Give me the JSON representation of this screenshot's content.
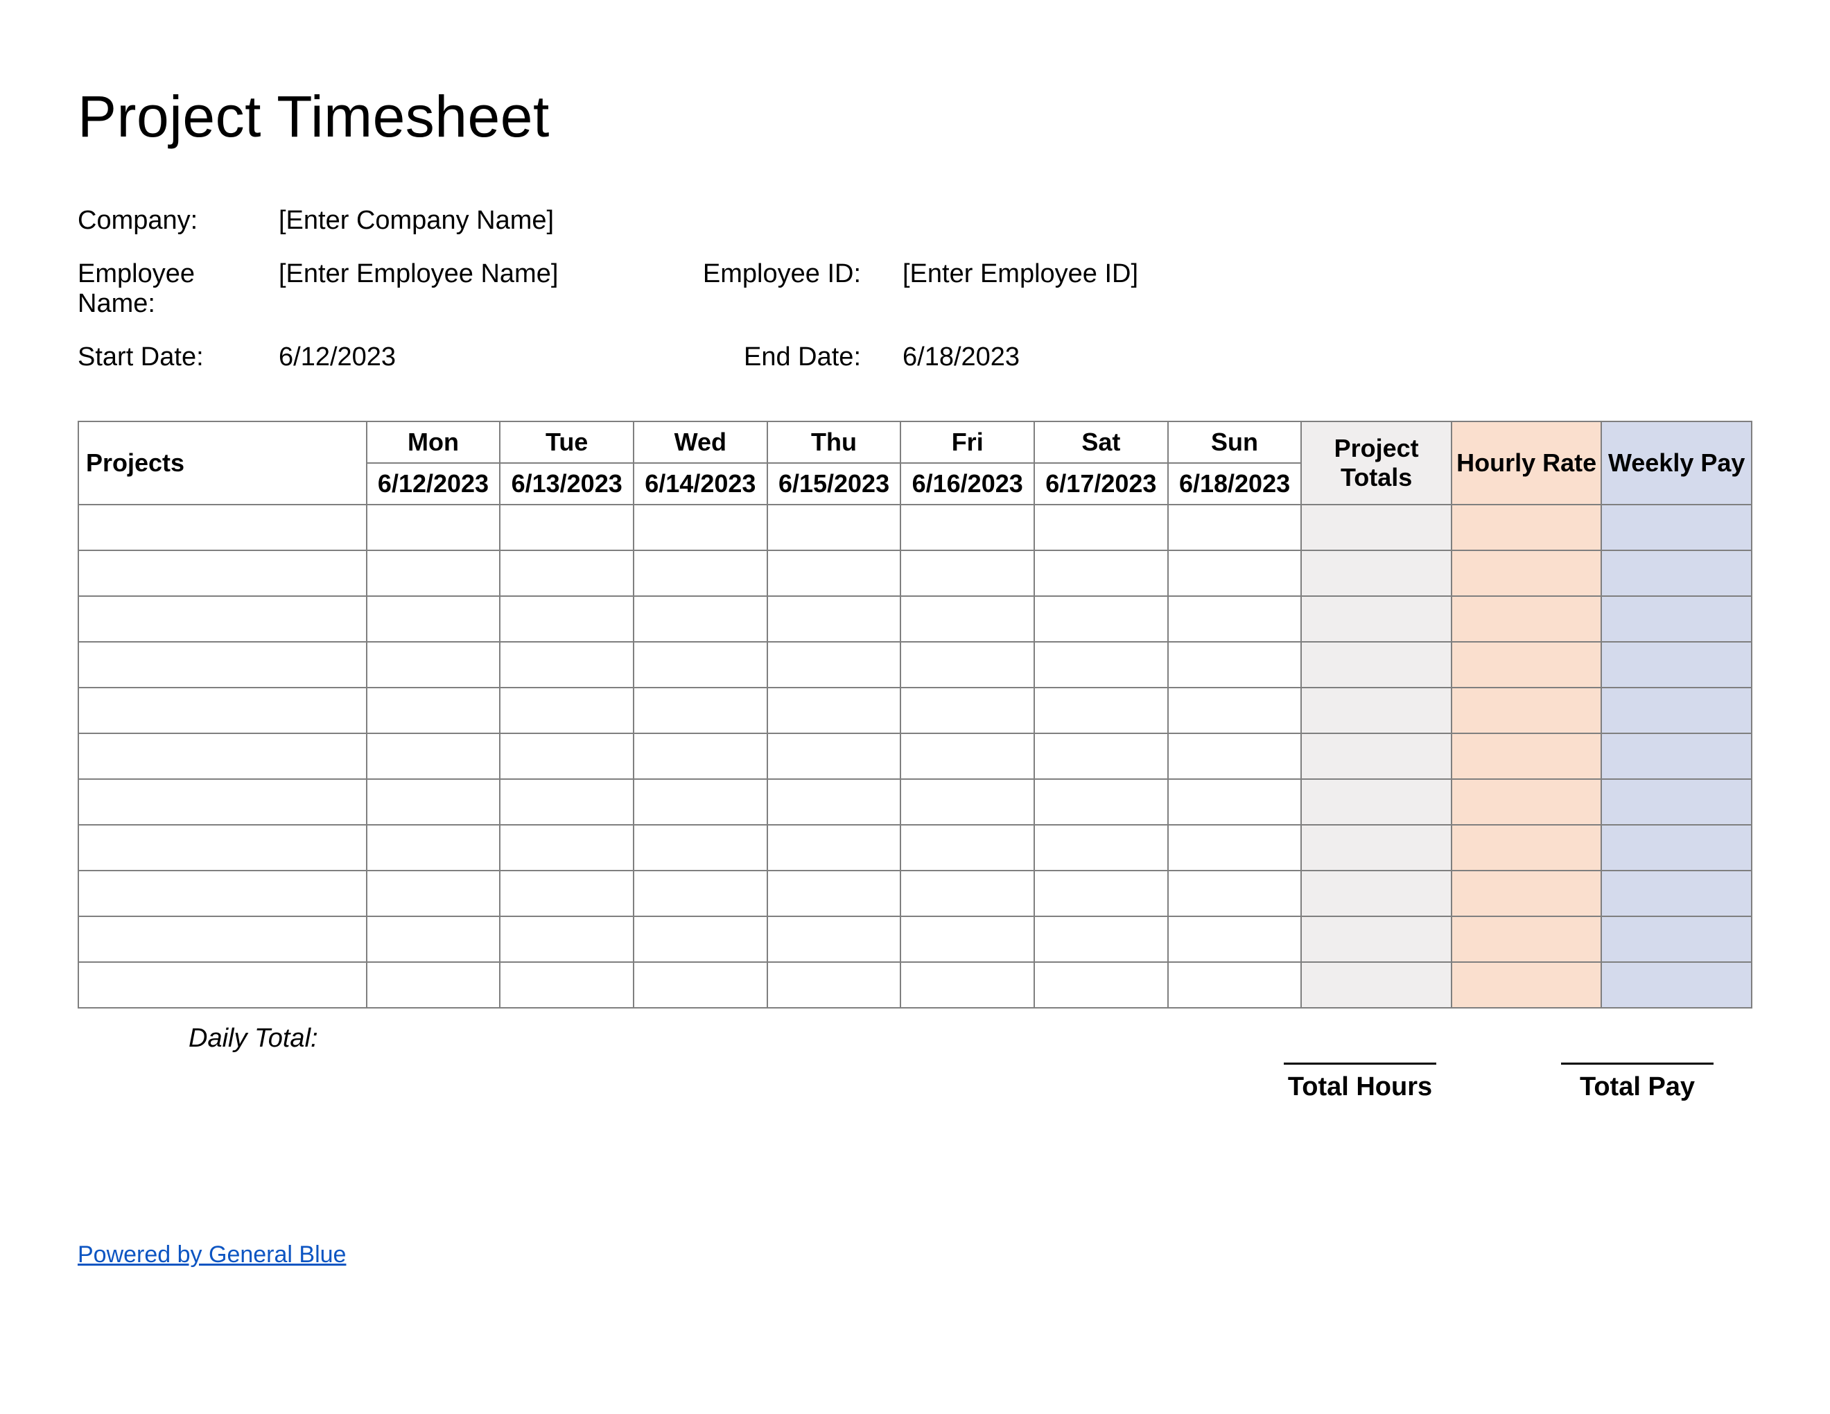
{
  "title": "Project Timesheet",
  "meta": {
    "company_label": "Company:",
    "company_value": "[Enter Company Name]",
    "employee_name_label": "Employee Name:",
    "employee_name_value": "[Enter Employee Name]",
    "employee_id_label": "Employee ID:",
    "employee_id_value": "[Enter Employee ID]",
    "start_date_label": "Start Date:",
    "start_date_value": "6/12/2023",
    "end_date_label": "End Date:",
    "end_date_value": "6/18/2023"
  },
  "table": {
    "projects_header": "Projects",
    "days": [
      "Mon",
      "Tue",
      "Wed",
      "Thu",
      "Fri",
      "Sat",
      "Sun"
    ],
    "dates": [
      "6/12/2023",
      "6/13/2023",
      "6/14/2023",
      "6/15/2023",
      "6/16/2023",
      "6/17/2023",
      "6/18/2023"
    ],
    "project_totals_header": "Project Totals",
    "hourly_rate_header": "Hourly Rate",
    "weekly_pay_header": "Weekly Pay",
    "num_rows": 11
  },
  "footer": {
    "daily_total_label": "Daily Total:",
    "total_hours_label": "Total Hours",
    "total_pay_label": "Total Pay",
    "powered_by": "Powered by General Blue"
  }
}
